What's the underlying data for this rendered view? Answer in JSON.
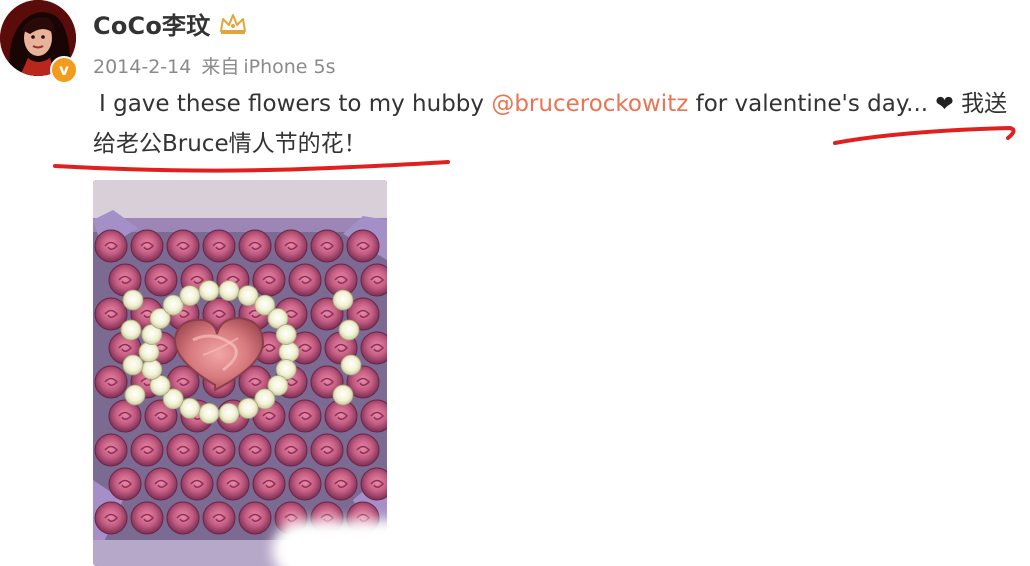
{
  "user": {
    "name": "CoCo李玟",
    "badge_glyph": "v",
    "badge_color": "#f29b1d",
    "crown_color": "#e0a63a"
  },
  "post": {
    "date": "2014-2-14",
    "source_prefix": "来自",
    "source_device": "iPhone 5s",
    "text_part1": "I gave these flowers to my hubby ",
    "mention": "@brucerockowitz",
    "text_part2": " for valentine's day... ",
    "heart_glyph": "❤",
    "text_part3": " 我送",
    "line2_text": "给老公Bruce情人节的花！",
    "mention_color": "#eb7350",
    "annotation_color": "#e0201f"
  }
}
